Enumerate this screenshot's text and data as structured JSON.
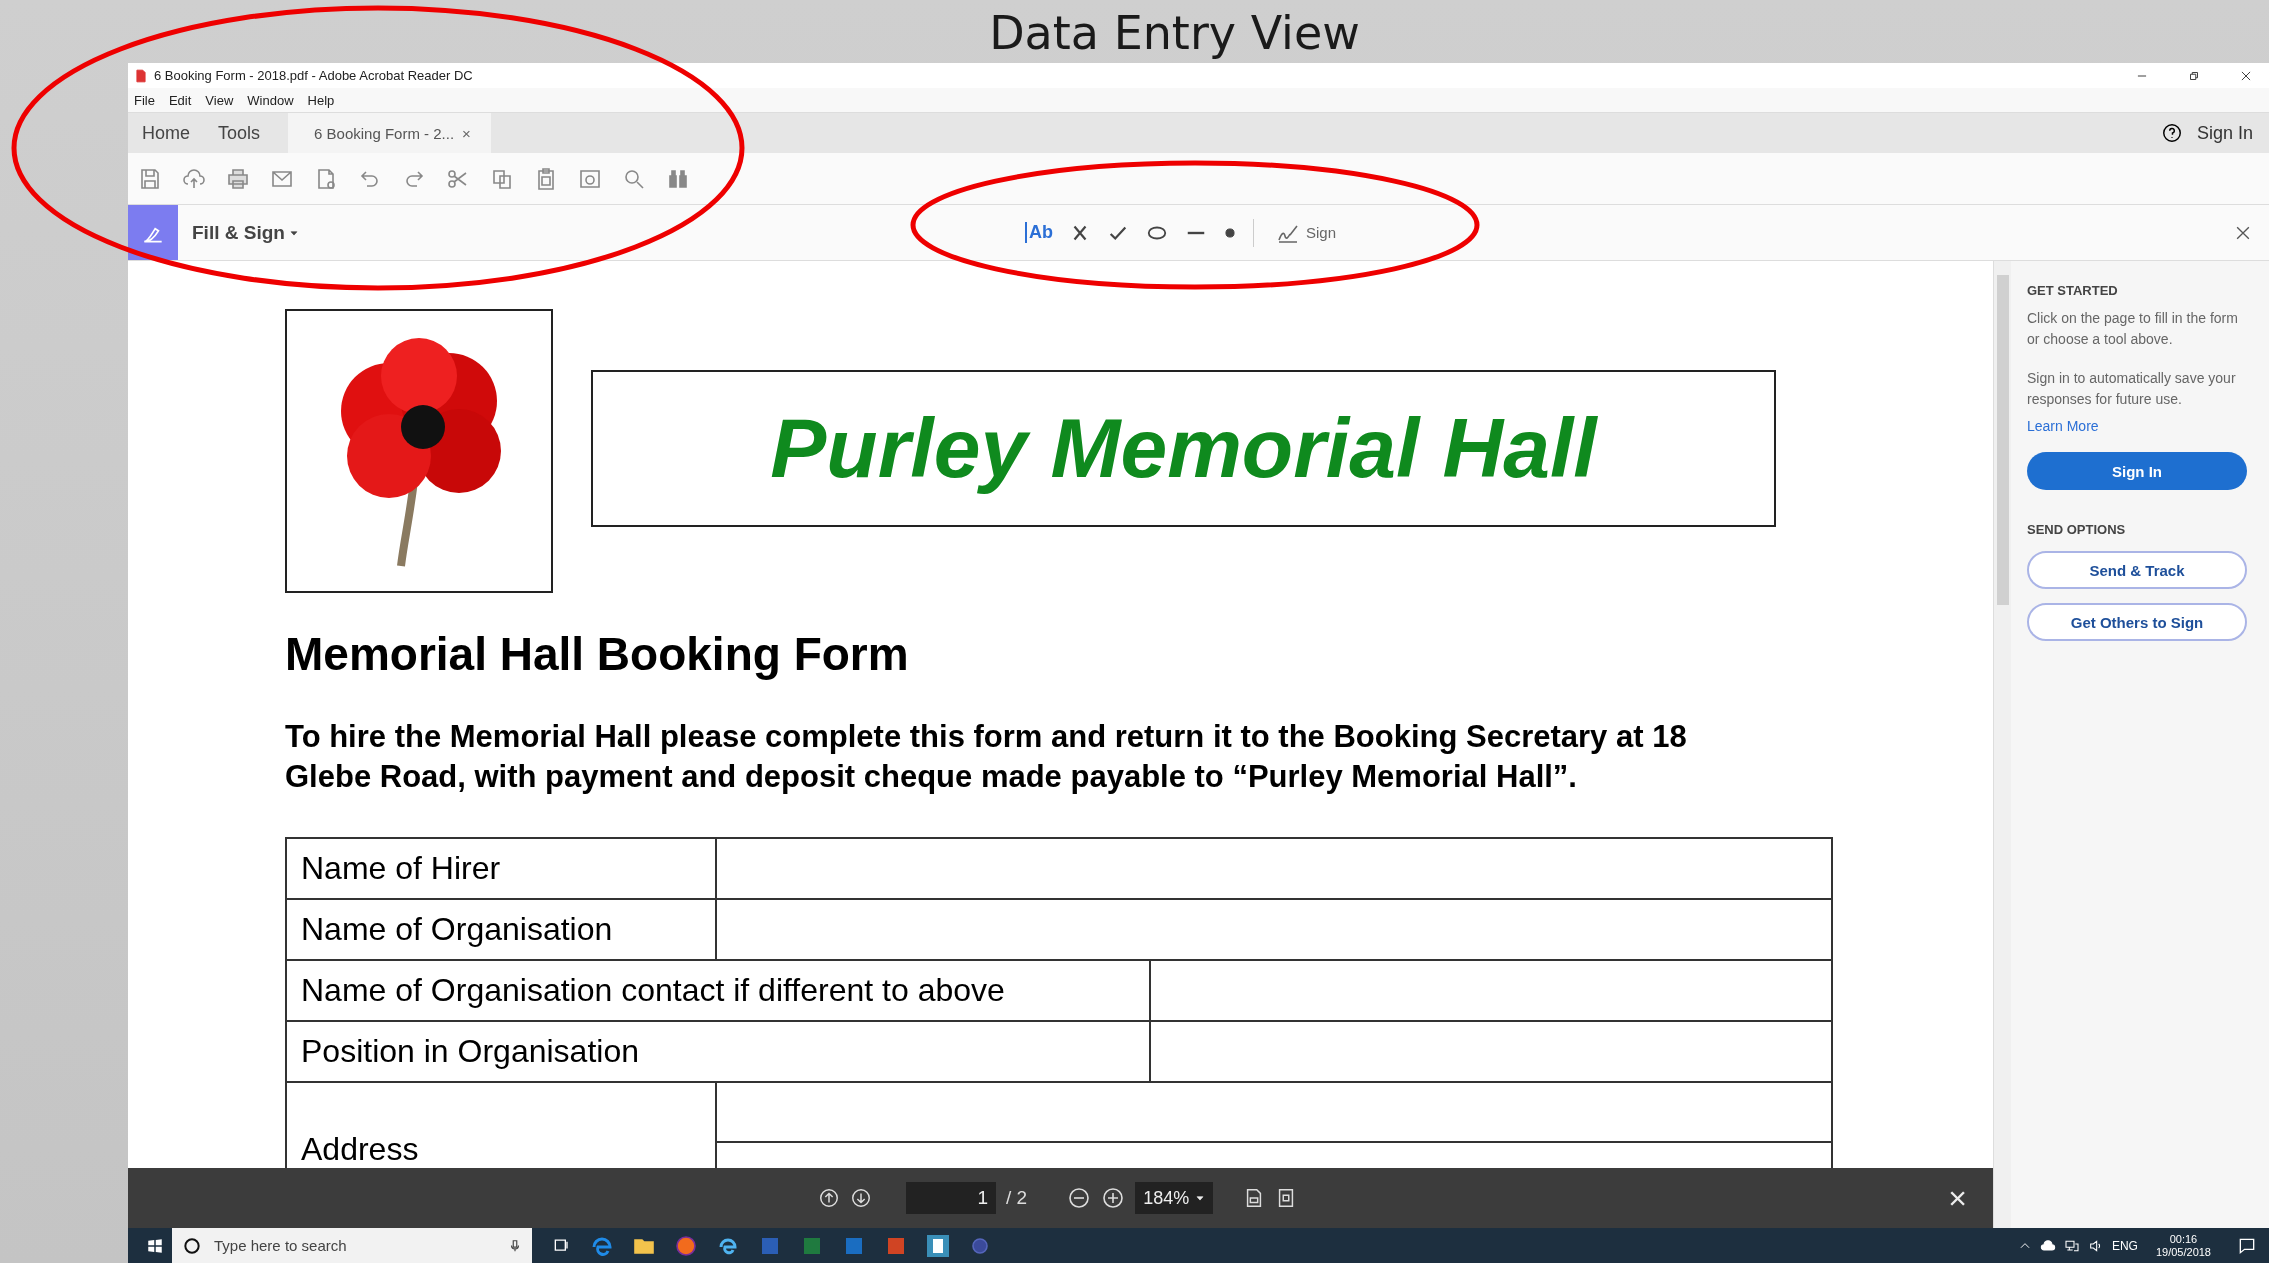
{
  "slide": {
    "title": "Data Entry View"
  },
  "window": {
    "title": "6 Booking Form - 2018.pdf - Adobe Acrobat Reader DC"
  },
  "menu": [
    "File",
    "Edit",
    "View",
    "Window",
    "Help"
  ],
  "tabs": [
    {
      "label": "Home",
      "selected": false
    },
    {
      "label": "Tools",
      "selected": false
    },
    {
      "label": "6 Booking Form - 2...",
      "selected": true,
      "close": "×"
    }
  ],
  "account": {
    "sign_in": "Sign In"
  },
  "fill_sign": {
    "label": "Fill & Sign",
    "add_text": "Ab",
    "sign": "Sign"
  },
  "document": {
    "heading": "Purley Memorial Hall",
    "form_title": "Memorial Hall Booking Form",
    "intro": "To hire the Memorial Hall please complete this form and return it to the Booking Secretary at 18 Glebe Road, with payment and deposit cheque made payable to “Purley Memorial Hall”.",
    "rows": [
      {
        "label": "Name of Hirer",
        "kind": "short"
      },
      {
        "label": "Name of Organisation",
        "kind": "short"
      },
      {
        "label": "Name of Organisation contact if different to above",
        "kind": "long"
      },
      {
        "label": "Position in Organisation",
        "kind": "long"
      },
      {
        "label": "Address",
        "kind": "address"
      }
    ]
  },
  "side_panel": {
    "get_started": "GET STARTED",
    "hint": "Click on the page to fill in the form or choose a tool above.",
    "sign_hint": "Sign in to automatically save your responses for future use.",
    "learn_more": "Learn More",
    "sign_in": "Sign In",
    "send_options": "SEND OPTIONS",
    "buttons": [
      "Send & Track",
      "Get Others to Sign"
    ]
  },
  "page_nav": {
    "page": "1",
    "total": "/ 2",
    "zoom": "184%",
    "close": "×"
  },
  "taskbar": {
    "search_placeholder": "Type here to search",
    "language": "ENG",
    "time": "00:16",
    "date": "19/05/2018"
  }
}
